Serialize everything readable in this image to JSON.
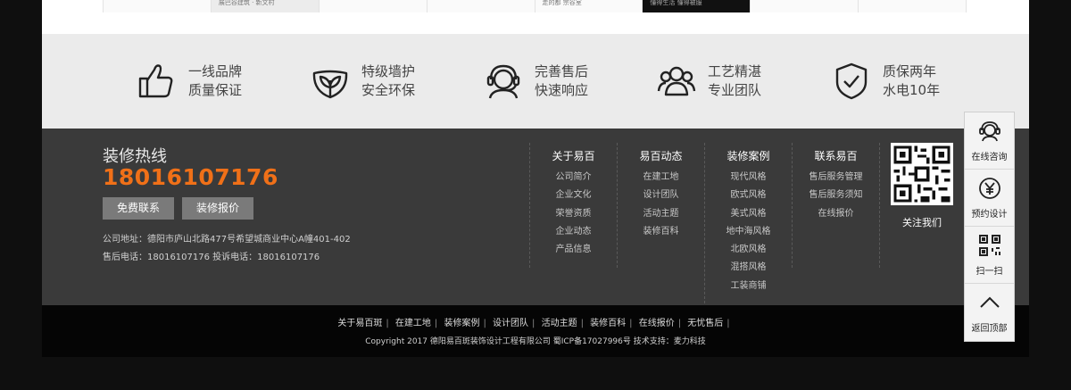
{
  "thumbs": [
    {
      "label": "",
      "style": "plain"
    },
    {
      "label": "展巴谷建筑 · 新文村",
      "style": "grey"
    },
    {
      "label": "",
      "style": "plain"
    },
    {
      "label": "",
      "style": "plain"
    },
    {
      "label": "走的都 宗谷室",
      "style": "plain"
    },
    {
      "label": "懂得生活 懂得被服",
      "style": "dark"
    },
    {
      "label": "",
      "style": "plain"
    },
    {
      "label": "",
      "style": "plain"
    }
  ],
  "features": [
    {
      "line1": "一线品牌",
      "line2": "质量保证",
      "icon": "thumbs-up-icon"
    },
    {
      "line1": "特级墙护",
      "line2": "安全环保",
      "icon": "leaf-shield-icon"
    },
    {
      "line1": "完善售后",
      "line2": "快速响应",
      "icon": "headset-icon"
    },
    {
      "line1": "工艺精湛",
      "line2": "专业团队",
      "icon": "team-icon"
    },
    {
      "line1": "质保两年",
      "line2": "水电10年",
      "icon": "check-shield-icon"
    }
  ],
  "contact": {
    "hotline_label": "装修热线",
    "hotline_number": "18016107176",
    "btn_free_contact": "免费联系",
    "btn_quote": "装修报价",
    "address": "公司地址：德阳市庐山北路477号希望城商业中心A幢401-402",
    "phones": "售后电话：18016107176 投诉电话：18016107176"
  },
  "columns": [
    {
      "title": "关于易百",
      "items": [
        "公司简介",
        "企业文化",
        "荣誉资质",
        "企业动态",
        "产品信息"
      ]
    },
    {
      "title": "易百动态",
      "items": [
        "在建工地",
        "设计团队",
        "活动主题",
        "装修百科"
      ]
    },
    {
      "title": "装修案例",
      "items": [
        "现代风格",
        "欧式风格",
        "美式风格",
        "地中海风格",
        "北欧风格",
        "混搭风格",
        "工装商铺"
      ]
    },
    {
      "title": "联系易百",
      "items": [
        "售后服务管理",
        "售后服务须知",
        "在线报价"
      ]
    }
  ],
  "qr": {
    "label": "关注我们"
  },
  "bottom": {
    "links": [
      "关于易百斑",
      "在建工地",
      "装修案例",
      "设计团队",
      "活动主题",
      "装修百科",
      "在线报价",
      "无忧售后"
    ],
    "copyright": "Copyright 2017 德阳易百斑装饰设计工程有限公司 蜀ICP备17027996号 技术支持：麦力科技"
  },
  "float_panel": [
    {
      "label": "在线咨询",
      "icon": "headset-icon"
    },
    {
      "label": "预约设计",
      "icon": "yen-icon"
    },
    {
      "label": "扫一扫",
      "icon": "qr-code-icon"
    },
    {
      "label": "返回顶部",
      "icon": "chevron-up-icon"
    }
  ],
  "colors": {
    "accent": "#f07018",
    "dark_band": "#3a3a3a",
    "light_band": "#ebebeb"
  }
}
